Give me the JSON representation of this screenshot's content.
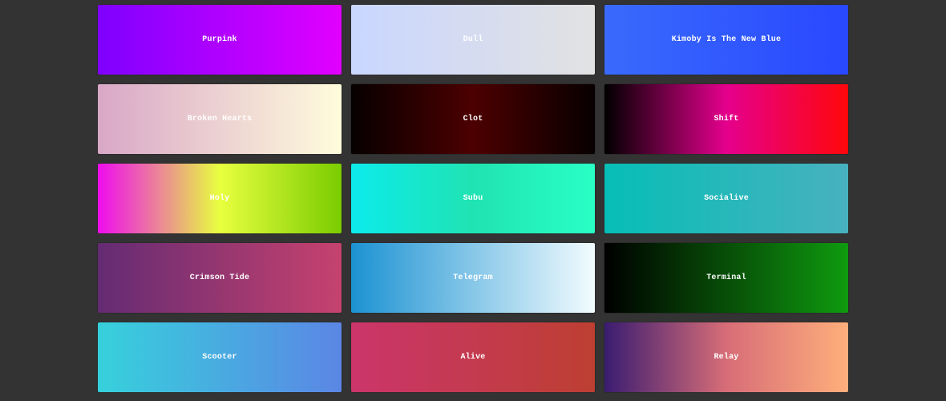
{
  "gradients": [
    {
      "name": "Purpink",
      "colors": [
        "#7F00FF",
        "#E100FF"
      ]
    },
    {
      "name": "Dull",
      "colors": [
        "#C9D6FF",
        "#E2E2E2"
      ]
    },
    {
      "name": "Kimoby Is The New Blue",
      "colors": [
        "#396AFC",
        "#2948FF"
      ]
    },
    {
      "name": "Broken Hearts",
      "colors": [
        "#D9A7C7",
        "#FFFCDC"
      ]
    },
    {
      "name": "Clot",
      "colors": [
        "#070000",
        "#4C0001",
        "#070000"
      ]
    },
    {
      "name": "Shift",
      "colors": [
        "#000000",
        "#E5008D",
        "#FF070B"
      ]
    },
    {
      "name": "Holy",
      "colors": [
        "#EE0CEE",
        "#E8FF3F",
        "#7ACC00"
      ]
    },
    {
      "name": "Subu",
      "colors": [
        "#0CEBEB",
        "#20E3B2",
        "#29FFC6"
      ]
    },
    {
      "name": "Socialive",
      "colors": [
        "#06BEB6",
        "#48B1BF"
      ]
    },
    {
      "name": "Crimson Tide",
      "colors": [
        "#642B73",
        "#C6426E"
      ]
    },
    {
      "name": "Telegram",
      "colors": [
        "#1C92D2",
        "#F2FCFE"
      ]
    },
    {
      "name": "Terminal",
      "colors": [
        "#000000",
        "#0F9B0F"
      ]
    },
    {
      "name": "Scooter",
      "colors": [
        "#36D1DC",
        "#5B86E5"
      ]
    },
    {
      "name": "Alive",
      "colors": [
        "#CB356B",
        "#BD3F32"
      ]
    },
    {
      "name": "Relay",
      "colors": [
        "#3A1C71",
        "#D76D77",
        "#FFAF7B"
      ]
    }
  ]
}
